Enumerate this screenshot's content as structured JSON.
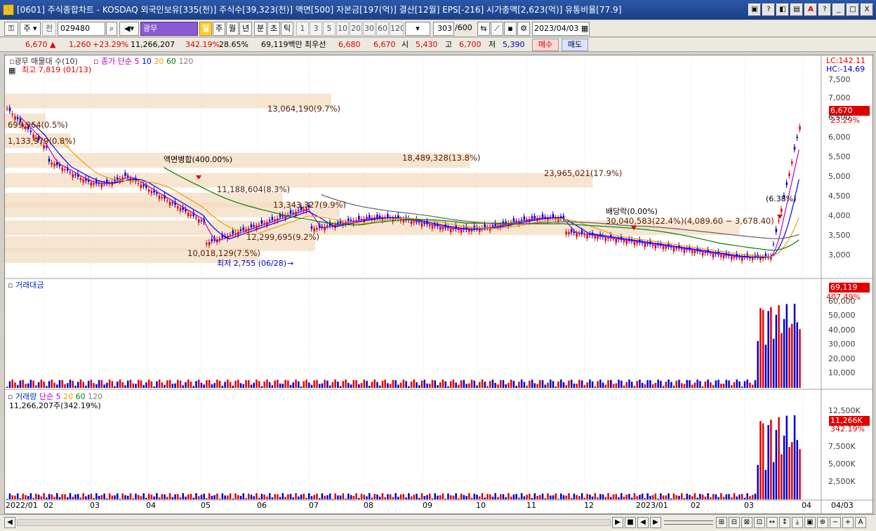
{
  "window": {
    "title": "[0601] 주식종합차트 - KOSDAQ 외국인보유[335(천)] 주식수[39,323(천)] 액면[500] 자본금[197(억)] 결산[12월] EPS[-216] 시가총액[2,623(억)] 유통비율[77.9]",
    "buttons": [
      "▣",
      "?",
      "◧",
      "▤",
      "A",
      "?",
      "_",
      "□",
      "X"
    ]
  },
  "toolbar": {
    "type_label": "주",
    "code_label": "전",
    "code_value": "029480",
    "stock_name": "광무",
    "period_tabs": [
      "일",
      "주",
      "월",
      "년",
      "분",
      "초",
      "틱"
    ],
    "period_selected": "일",
    "intervals": [
      "1",
      "3",
      "5",
      "10",
      "20",
      "30",
      "60",
      "120"
    ],
    "count_value": "303",
    "count_total": "/600",
    "date_value": "2023/04/03"
  },
  "quote": {
    "price": "6,670",
    "change": "1,260",
    "change_pct": "+23.29%",
    "volume": "11,266,207",
    "volume_ratio": "342.19%",
    "turnover": "28.65%",
    "amount": "69,119백만",
    "best_bid_label": "최우선",
    "ask": "6,680",
    "bid": "6,670",
    "open_label": "시",
    "open": "5,430",
    "high_label": "고",
    "high": "6,700",
    "low_label": "저",
    "low": "5,390",
    "buy_label": "매수",
    "sell_label": "매도"
  },
  "price_pane": {
    "legend_title": "광무 매물대 수(10)",
    "legend_ma": "종가 단순",
    "ma_periods": [
      "5",
      "10",
      "20",
      "60",
      "120"
    ],
    "ma_colors": [
      "#c000c0",
      "#0000ff",
      "#f0a000",
      "#008000",
      "#606060"
    ],
    "max_label": "최고 7,819 (01/13)",
    "min_label": "최저 2,755 (06/28)",
    "lc_label": "LC:142.11",
    "hc_label": "HC:-14.69",
    "price_tag": "6,670",
    "pct_tag": "23.29%",
    "event_face": "액면병합(400.00%)",
    "event_div": "배당락(0.00%)",
    "event_pct": "(6.38%)",
    "y_ticks": [
      "7,500",
      "7,000",
      "6,500",
      "6,000",
      "5,500",
      "5,000",
      "4,500",
      "4,000",
      "3,500",
      "3,000"
    ]
  },
  "volume_profile": [
    {
      "label": "13,064,190(9.7%)",
      "price": 7000,
      "width": 0.4
    },
    {
      "label": "699,964(0.5%)",
      "price": 6500,
      "width": 0.05
    },
    {
      "label": "1,133,979(0.8%)",
      "price": 6000,
      "width": 0.08
    },
    {
      "label": "18,489,328(13.8%)",
      "price": 5500,
      "width": 0.57
    },
    {
      "label": "23,965,021(17.9%)",
      "price": 5000,
      "width": 0.72
    },
    {
      "label": "11,188,604(8.3%)",
      "price": 4500,
      "width": 0.34
    },
    {
      "label": "13,343,327(9.9%)",
      "price": 4250,
      "width": 0.41
    },
    {
      "label": "30,040,583(22.4%)(4,089.60 ~ 3,678.40)",
      "price": 3800,
      "width": 0.9
    },
    {
      "label": "12,299,695(9.2%)",
      "price": 3400,
      "width": 0.38
    },
    {
      "label": "10,018,129(7.5%)",
      "price": 3100,
      "width": 0.31
    }
  ],
  "amount_pane": {
    "title": "거래대금",
    "tag": "69,119",
    "pct_tag": "407.49%",
    "y_ticks": [
      "60,000",
      "50,000",
      "40,000",
      "30,000",
      "20,000",
      "10,000"
    ]
  },
  "volume_pane": {
    "title": "거래량",
    "ma_label": "단순",
    "ma_periods": [
      "5",
      "20",
      "60",
      "120"
    ],
    "value_label": "11,266,207주(342.19%)",
    "tag": "11,266K",
    "pct_tag": "342.19%",
    "y_ticks": [
      "12,500K",
      "10,000K",
      "7,500K",
      "5,000K",
      "2,500K"
    ]
  },
  "x_axis": {
    "months": [
      "2022/01",
      "02",
      "03",
      "04",
      "05",
      "06",
      "07",
      "08",
      "09",
      "10",
      "11",
      "12",
      "2023/01",
      "02",
      "03",
      "04"
    ],
    "right_label": "04/03"
  },
  "footer": {
    "nav_buttons": [
      "▶",
      "■",
      "◀",
      "▶"
    ],
    "tool_buttons": [
      "⊞",
      "⊟",
      "⊠",
      "⊡",
      "↔",
      "↕",
      "⤓",
      "▣",
      "⊕",
      "−",
      "+",
      "A"
    ]
  }
}
